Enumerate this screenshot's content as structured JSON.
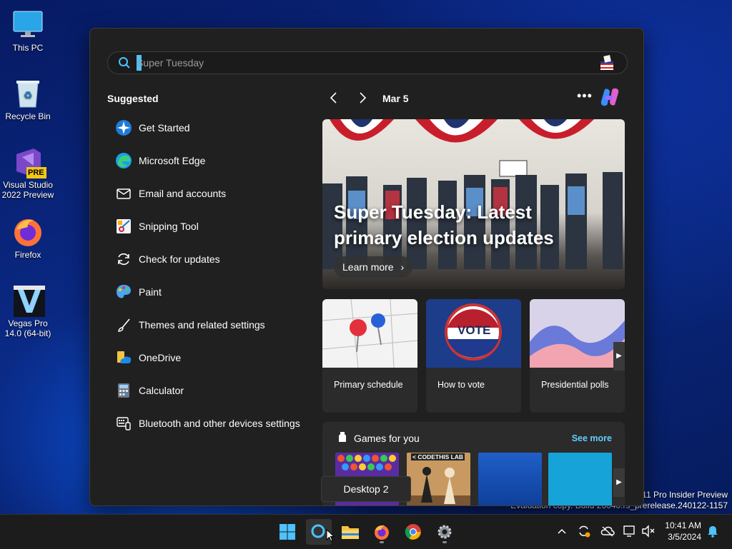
{
  "desktop": {
    "icons": [
      {
        "label": "This PC"
      },
      {
        "label": "Recycle Bin"
      },
      {
        "label": "Visual Studio 2022 Preview",
        "badge": "PRE"
      },
      {
        "label": "Firefox"
      },
      {
        "label": "Vegas Pro 14.0 (64-bit)"
      }
    ],
    "watermark": {
      "line1": "s 11 Pro Insider Preview",
      "line2": "Evaluation copy. Build 26040.rs_prerelease.240122-1157"
    }
  },
  "search": {
    "query_placeholder": "Super Tuesday"
  },
  "suggested": {
    "title": "Suggested",
    "items": [
      {
        "label": "Get Started",
        "icon": "get-started-icon"
      },
      {
        "label": "Microsoft Edge",
        "icon": "edge-icon"
      },
      {
        "label": "Email and accounts",
        "icon": "mail-icon"
      },
      {
        "label": "Snipping Tool",
        "icon": "snipping-tool-icon"
      },
      {
        "label": "Check for updates",
        "icon": "refresh-icon"
      },
      {
        "label": "Paint",
        "icon": "paint-icon"
      },
      {
        "label": "Themes and related settings",
        "icon": "brush-icon"
      },
      {
        "label": "OneDrive",
        "icon": "onedrive-icon"
      },
      {
        "label": "Calculator",
        "icon": "calculator-icon"
      },
      {
        "label": "Bluetooth and other devices settings",
        "icon": "devices-icon"
      }
    ]
  },
  "highlights": {
    "date": "Mar 5",
    "hero": {
      "title": "Super Tuesday: Latest primary election updates",
      "button": "Learn more"
    },
    "cards": [
      {
        "label": "Primary schedule"
      },
      {
        "label": "How to vote",
        "image_text": "VOTE"
      },
      {
        "label": "Presidential polls"
      }
    ],
    "games": {
      "title": "Games for you",
      "see_more": "See more",
      "tile1_text": "< CODETHIS LAB"
    }
  },
  "tooltip": {
    "text": "Desktop 2"
  },
  "taskbar": {
    "time": "10:41 AM",
    "date": "3/5/2024"
  },
  "colors": {
    "accent": "#4cc2ff",
    "panel_bg": "#202020",
    "card_bg": "#2b2b2b",
    "link": "#60cdff"
  }
}
